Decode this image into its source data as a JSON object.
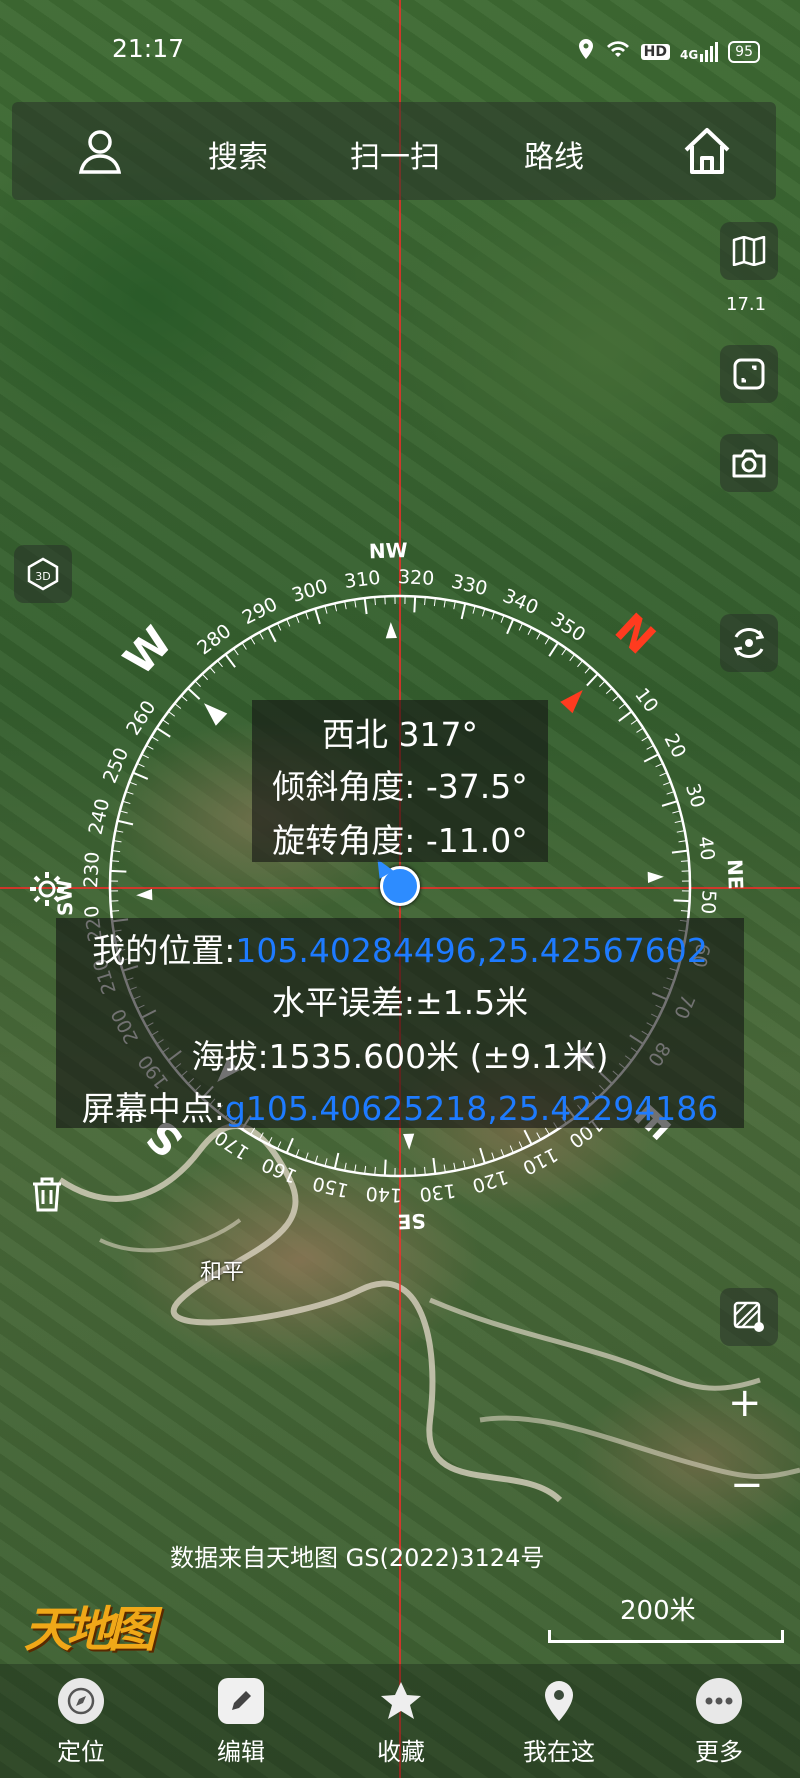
{
  "status_bar": {
    "time": "21:17",
    "network_hd": "HD",
    "network_4g": "4G",
    "battery": "95"
  },
  "top_bar": {
    "search": "搜索",
    "scan": "扫一扫",
    "route": "路线"
  },
  "right_tools": {
    "zoom_level": "17.1",
    "zoom_in": "+",
    "zoom_out": "−"
  },
  "compass": {
    "heading_text": "西北 317°",
    "tilt_text": "倾斜角度: -37.5°",
    "rotation_text": "旋转角度: -11.0°",
    "heading_deg": 317,
    "cardinals": [
      "N",
      "NE",
      "E",
      "SE",
      "S",
      "SW",
      "W",
      "NW"
    ],
    "degree_labels": [
      "10",
      "20",
      "30",
      "40",
      "50",
      "60",
      "70",
      "80",
      "100",
      "110",
      "120",
      "130",
      "140",
      "150",
      "160",
      "170",
      "190",
      "200",
      "210",
      "220",
      "230",
      "240",
      "250",
      "260",
      "280",
      "290",
      "300",
      "310",
      "320",
      "330",
      "340",
      "350"
    ]
  },
  "location_info": {
    "my_location_label": "我的位置:",
    "my_location_value": "105.40284496,25.42567602",
    "horizontal_error": "水平误差:±1.5米",
    "altitude": "海拔:1535.600米 (±9.1米)",
    "screen_center_label": "屏幕中点:",
    "screen_center_value": "g105.40625218,25.42294186"
  },
  "map": {
    "place_label": "和平",
    "attribution": "数据来自天地图 GS(2022)3124号",
    "logo_text": "天地图",
    "scale_label": "200米"
  },
  "bottom_nav": {
    "items": [
      {
        "label": "定位",
        "icon": "compass-icon"
      },
      {
        "label": "编辑",
        "icon": "pencil-icon"
      },
      {
        "label": "收藏",
        "icon": "star-icon"
      },
      {
        "label": "我在这",
        "icon": "location-pin-icon"
      },
      {
        "label": "更多",
        "icon": "more-dots-icon"
      }
    ]
  },
  "colors": {
    "north_accent": "#ff3b1f",
    "coordinate_blue": "#1e7bff",
    "crosshair_red": "#ff2020"
  }
}
